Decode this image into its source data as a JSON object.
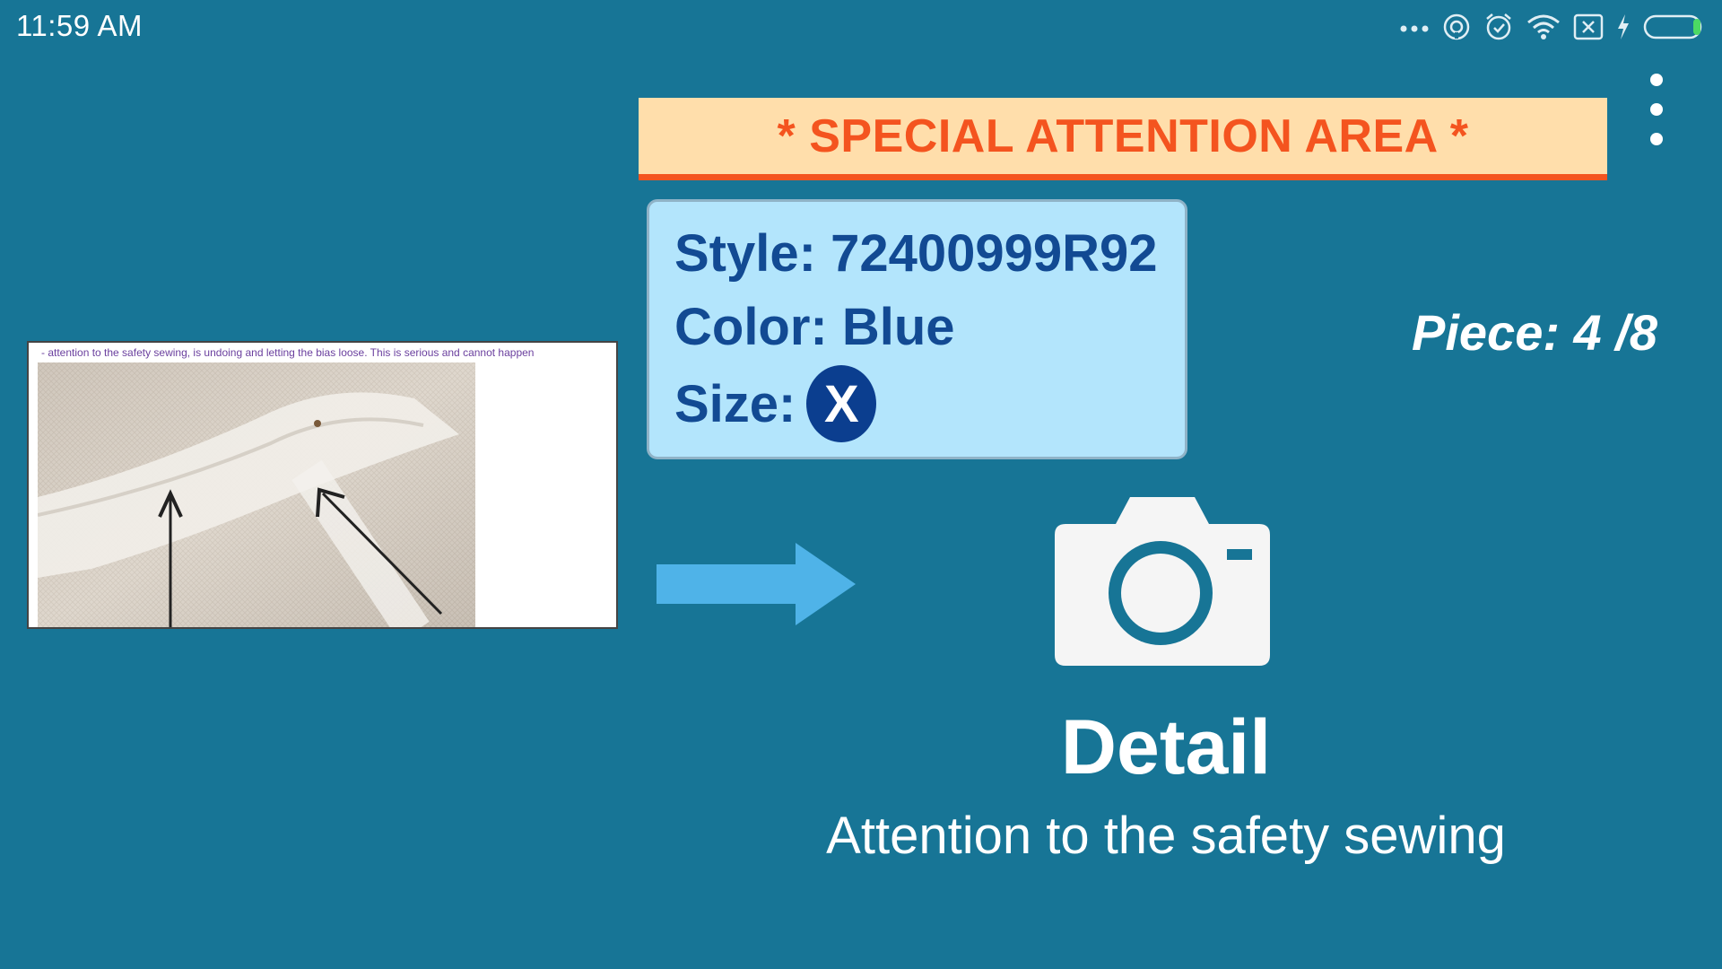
{
  "status_bar": {
    "time": "11:59  AM",
    "icons": [
      "more-dots-icon",
      "hotspot-icon",
      "alarm-icon",
      "wifi-icon",
      "sim-off-icon",
      "charging-icon",
      "battery-icon"
    ]
  },
  "menu": {
    "icon": "overflow-menu-icon"
  },
  "banner": {
    "text": "* SPECIAL ATTENTION AREA *"
  },
  "info": {
    "style_label": "Style:",
    "style_value": "72400999R92",
    "color_label": "Color:",
    "color_value": "Blue",
    "size_label": "Size:",
    "size_value": "X"
  },
  "piece": {
    "text": "Piece: 4 /8"
  },
  "reference_image": {
    "caption": "- attention to the safety sewing, is undoing and letting the bias loose. This is serious and cannot happen"
  },
  "detail": {
    "title": "Detail",
    "subtitle": "Attention to the safety sewing"
  },
  "colors": {
    "background": "#177596",
    "banner_bg": "#ffdeab",
    "banner_accent": "#f4541f",
    "card_bg": "#b3e5fc",
    "card_text": "#124a93",
    "badge_bg": "#0b3e8f",
    "arrow": "#4fb3e8"
  }
}
